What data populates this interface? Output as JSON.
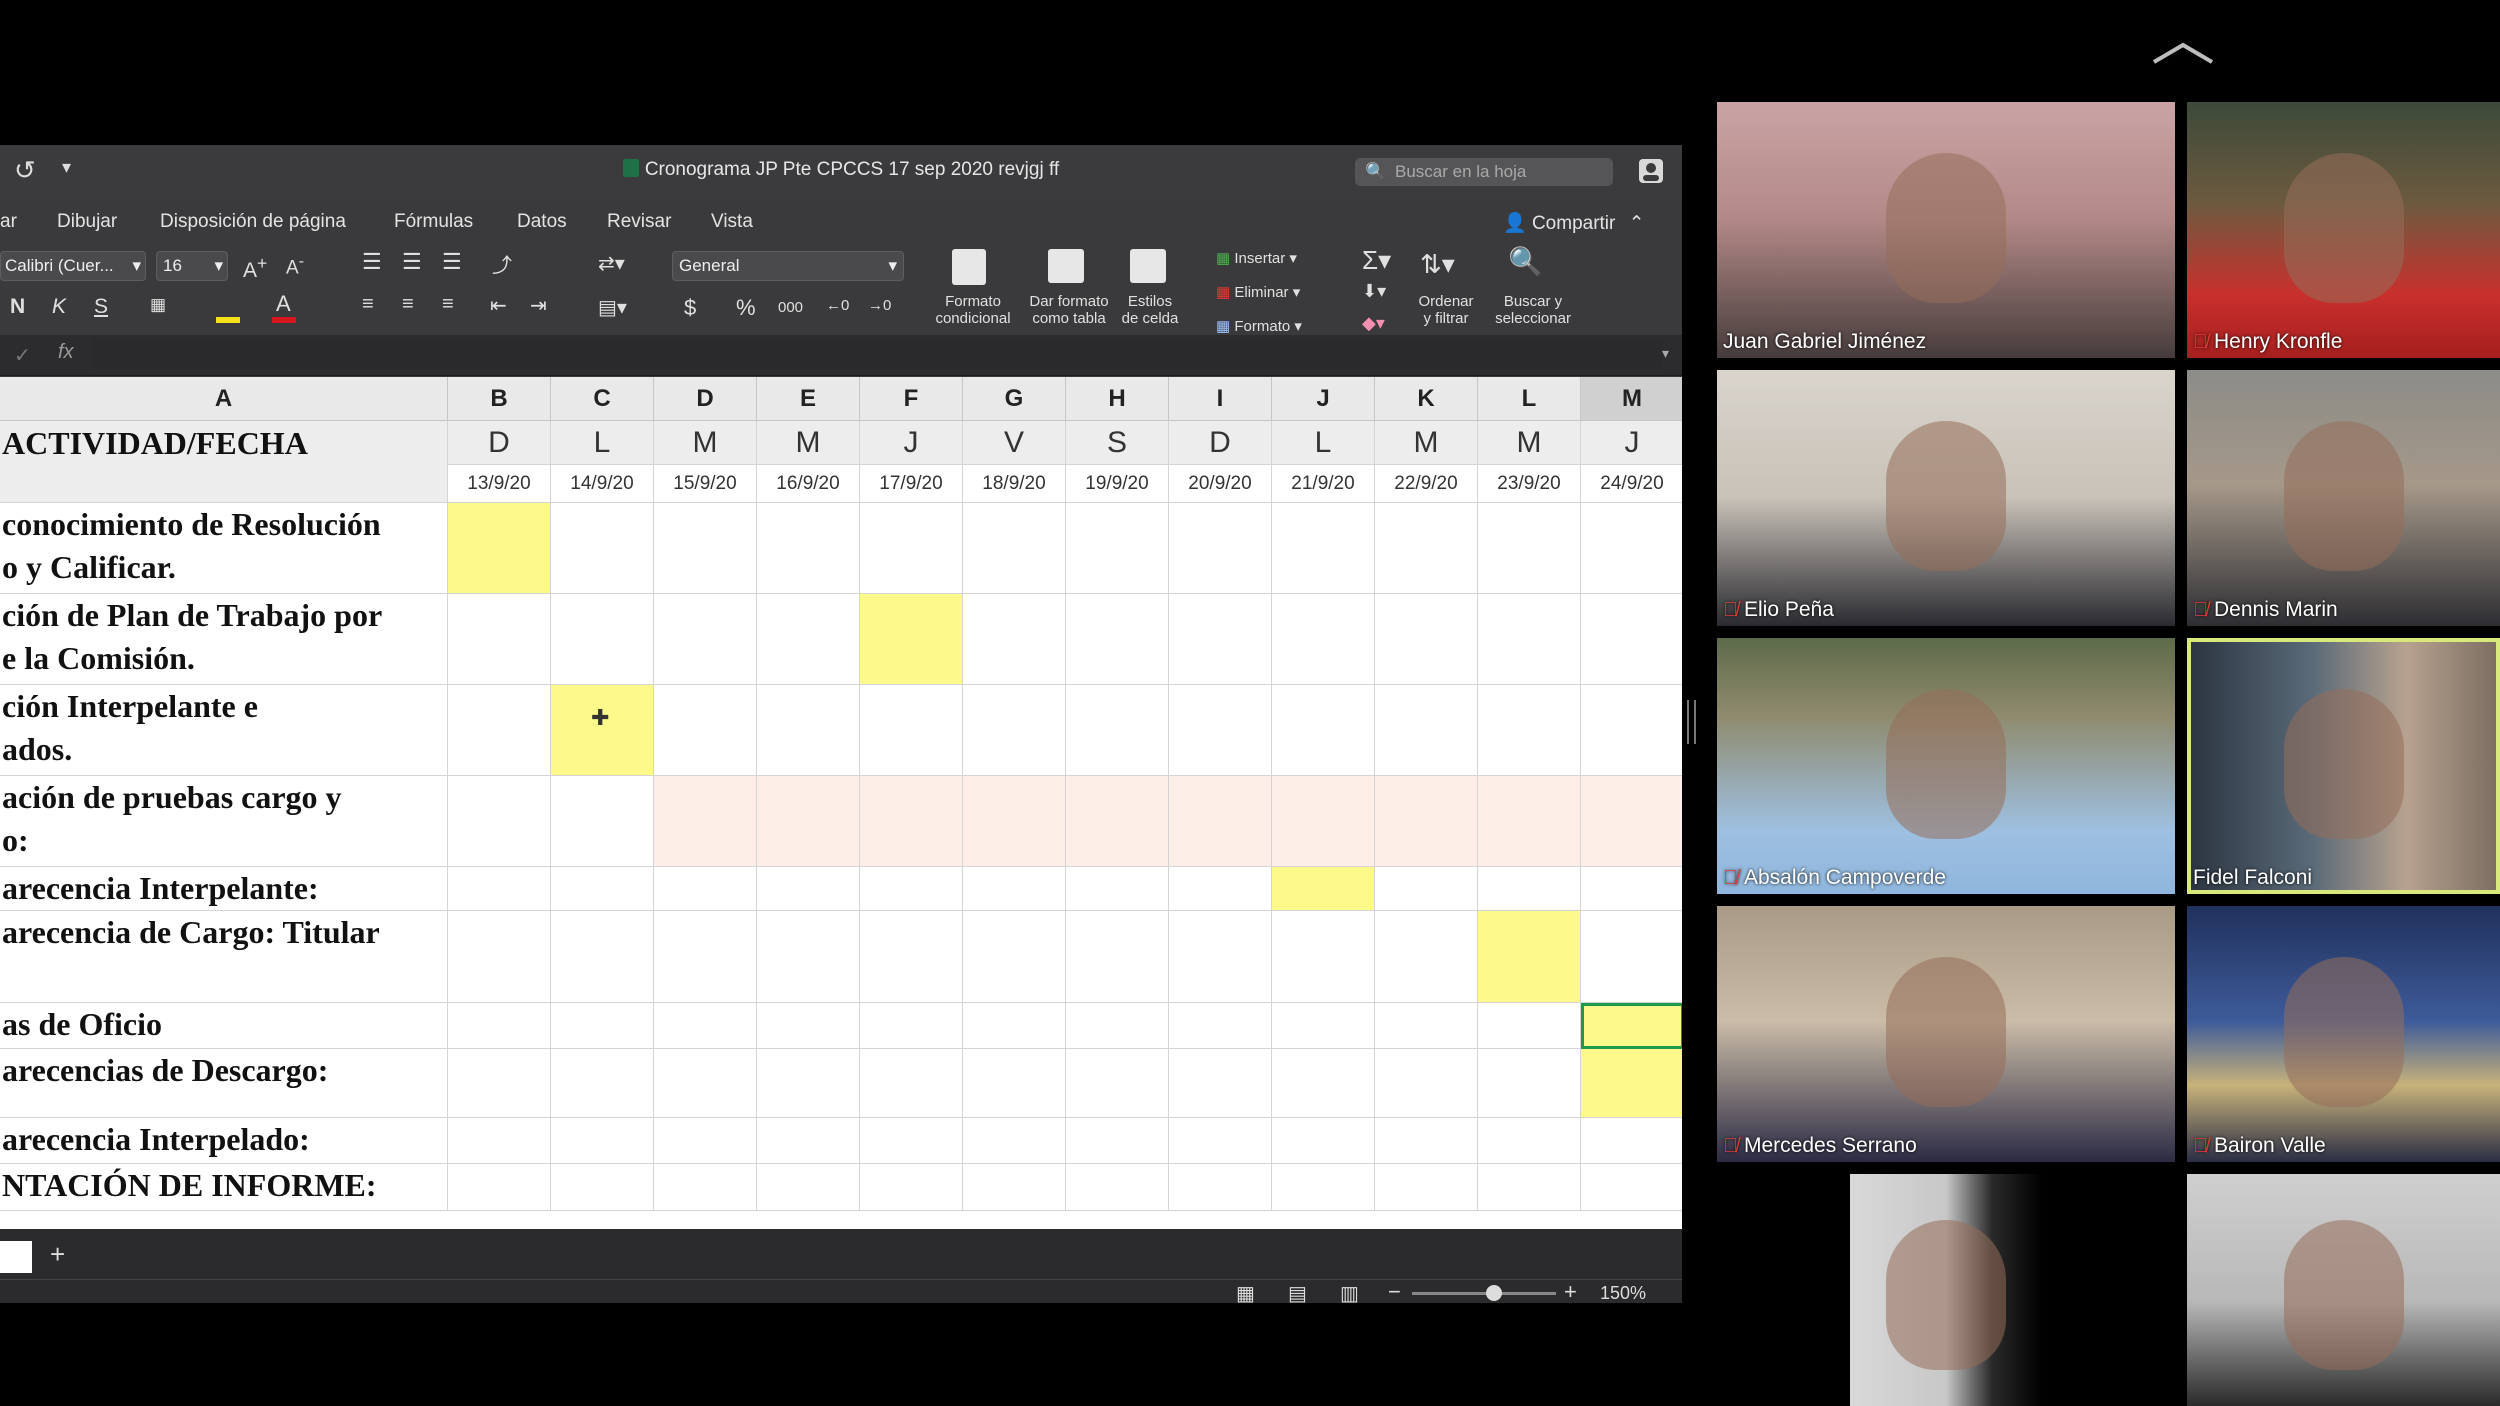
{
  "window": {
    "title": "Cronograma JP Pte CPCCS 17 sep 2020 revjgj ff",
    "search_placeholder": "Buscar en la hoja"
  },
  "menu": [
    "ar",
    "Dibujar",
    "Disposición de página",
    "Fórmulas",
    "Datos",
    "Revisar",
    "Vista"
  ],
  "share_label": "Compartir",
  "ribbon": {
    "font_name": "Calibri (Cuer...",
    "font_size": "16",
    "number_format": "General",
    "currency": "$",
    "percent": "%",
    "thousands": "000",
    "cond_format": [
      "Formato",
      "condicional"
    ],
    "format_table": [
      "Dar formato",
      "como tabla"
    ],
    "cell_styles": [
      "Estilos",
      "de celda"
    ],
    "insert": "Insertar",
    "delete": "Eliminar",
    "format": "Formato",
    "sort_filter": [
      "Ordenar",
      "y filtrar"
    ],
    "find_select": [
      "Buscar y",
      "seleccionar"
    ],
    "fx": "fx"
  },
  "sheet": {
    "column_headers": [
      "A",
      "B",
      "C",
      "D",
      "E",
      "F",
      "G",
      "H",
      "I",
      "J",
      "K",
      "L",
      "M"
    ],
    "header_label": "ACTIVIDAD/FECHA",
    "days": [
      "D",
      "L",
      "M",
      "M",
      "J",
      "V",
      "S",
      "D",
      "L",
      "M",
      "M",
      "J"
    ],
    "dates": [
      "13/9/20",
      "14/9/20",
      "15/9/20",
      "16/9/20",
      "17/9/20",
      "18/9/20",
      "19/9/20",
      "20/9/20",
      "21/9/20",
      "22/9/20",
      "23/9/20",
      "24/9/20"
    ],
    "rows": [
      {
        "lines": [
          "conocimiento de Resolución",
          "o y Calificar."
        ],
        "highlight": [
          0
        ]
      },
      {
        "lines": [
          "ción de Plan de Trabajo por",
          "e la Comisión."
        ],
        "highlight": [
          4
        ]
      },
      {
        "lines": [
          "ción Interpelante e",
          "ados."
        ],
        "highlight": [
          1
        ]
      },
      {
        "lines": [
          "ación de pruebas cargo y",
          "o:"
        ],
        "highlight": []
      },
      {
        "lines": [
          "arecencia Interpelante:"
        ],
        "highlight": [
          8
        ]
      },
      {
        "lines": [
          "arecencia de Cargo: Titular",
          ""
        ],
        "highlight": [
          10
        ]
      },
      {
        "lines": [
          "as de Oficio"
        ],
        "highlight": [
          11
        ]
      },
      {
        "lines": [
          "arecencias de Descargo:"
        ],
        "highlight": [
          11
        ]
      },
      {
        "lines": [
          "arecencia Interpelado:"
        ],
        "highlight": []
      },
      {
        "lines": [
          "NTACIÓN DE INFORME:"
        ],
        "highlight": []
      }
    ],
    "pink_row": 3
  },
  "status": {
    "zoom": "150%",
    "add_sheet": "+"
  },
  "participants": [
    {
      "name": "Juan Gabriel Jiménez",
      "muted": false
    },
    {
      "name": "Henry Kronfle",
      "muted": true
    },
    {
      "name": "Elio Peña",
      "muted": true
    },
    {
      "name": "Dennis Marin",
      "muted": true
    },
    {
      "name": "Absalón Campoverde",
      "muted": true
    },
    {
      "name": "Fidel Falconi",
      "muted": false
    },
    {
      "name": "Mercedes Serrano",
      "muted": true
    },
    {
      "name": "Bairon Valle",
      "muted": true
    },
    {
      "name": "",
      "muted": false
    },
    {
      "name": "",
      "muted": false
    }
  ],
  "colors": {
    "highlight": "#fdf98a",
    "pink": "#fdeee8",
    "active_speaker": "#d8e87a"
  }
}
